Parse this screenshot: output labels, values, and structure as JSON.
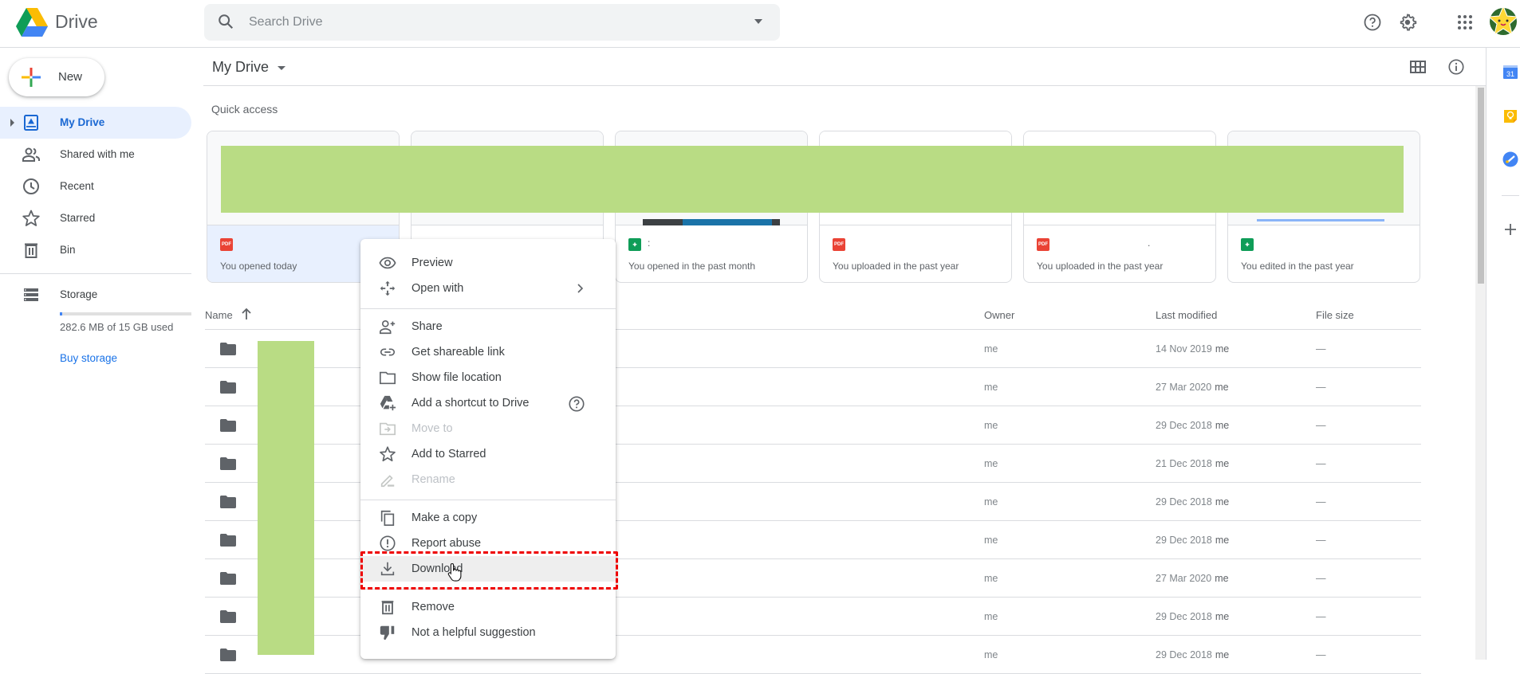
{
  "header": {
    "app_title": "Drive",
    "search_placeholder": "Search Drive",
    "icons": [
      "help-icon",
      "settings-icon",
      "apps-grid-icon",
      "avatar"
    ]
  },
  "sidebar": {
    "new_label": "New",
    "items": [
      {
        "label": "My Drive",
        "icon": "my-drive-icon",
        "active": true
      },
      {
        "label": "Shared with me",
        "icon": "shared-icon"
      },
      {
        "label": "Recent",
        "icon": "clock-icon"
      },
      {
        "label": "Starred",
        "icon": "star-icon"
      },
      {
        "label": "Bin",
        "icon": "trash-icon"
      }
    ],
    "storage": {
      "label": "Storage",
      "used_text": "282.6 MB of 15 GB used",
      "used_fraction": 0.018,
      "buy_label": "Buy storage"
    }
  },
  "toolbar": {
    "breadcrumb": "My Drive",
    "icons": [
      "grid-view-icon",
      "info-icon"
    ]
  },
  "quick_access": {
    "label": "Quick access",
    "cards": [
      {
        "type": "PDF",
        "reason": "You opened today",
        "selected": true
      },
      {
        "type": "",
        "reason": ""
      },
      {
        "type": "sheet",
        "reason": "You opened in the past month",
        "name": ":"
      },
      {
        "type": "PDF",
        "reason": "You uploaded in the past year"
      },
      {
        "type": "PDF",
        "reason": "You uploaded in the past year",
        "name": "."
      },
      {
        "type": "sheet",
        "reason": "You edited in the past year"
      }
    ]
  },
  "file_list": {
    "columns": {
      "name": "Name",
      "owner": "Owner",
      "modified": "Last modified",
      "size": "File size"
    },
    "rows": [
      {
        "owner": "me",
        "modified": "14 Nov 2019",
        "modified_by": "me",
        "size": "—"
      },
      {
        "owner": "me",
        "modified": "27 Mar 2020",
        "modified_by": "me",
        "size": "—"
      },
      {
        "owner": "me",
        "modified": "29 Dec 2018",
        "modified_by": "me",
        "size": "—"
      },
      {
        "owner": "me",
        "modified": "21 Dec 2018",
        "modified_by": "me",
        "size": "—"
      },
      {
        "owner": "me",
        "modified": "29 Dec 2018",
        "modified_by": "me",
        "size": "—"
      },
      {
        "owner": "me",
        "modified": "29 Dec 2018",
        "modified_by": "me",
        "size": "—"
      },
      {
        "owner": "me",
        "modified": "27 Mar 2020",
        "modified_by": "me",
        "size": "—"
      },
      {
        "owner": "me",
        "modified": "29 Dec 2018",
        "modified_by": "me",
        "size": "—"
      },
      {
        "owner": "me",
        "modified": "29 Dec 2018",
        "modified_by": "me",
        "size": "—"
      }
    ]
  },
  "context_menu": {
    "items": [
      {
        "label": "Preview",
        "icon": "eye-icon"
      },
      {
        "label": "Open with",
        "icon": "move-arrows-icon",
        "submenu": true
      },
      {
        "label": "Share",
        "icon": "person-add-icon"
      },
      {
        "label": "Get shareable link",
        "icon": "link-icon"
      },
      {
        "label": "Show file location",
        "icon": "folder-icon"
      },
      {
        "label": "Add a shortcut to Drive",
        "icon": "drive-shortcut-icon",
        "help": true
      },
      {
        "label": "Move to",
        "icon": "move-to-folder-icon",
        "disabled": true
      },
      {
        "label": "Add to Starred",
        "icon": "star-icon"
      },
      {
        "label": "Rename",
        "icon": "pencil-icon",
        "disabled": true
      },
      {
        "label": "Make a copy",
        "icon": "copy-icon"
      },
      {
        "label": "Report abuse",
        "icon": "alert-icon"
      },
      {
        "label": "Download",
        "icon": "download-icon",
        "hover": true,
        "highlighted": true
      },
      {
        "label": "Remove",
        "icon": "trash-icon"
      },
      {
        "label": "Not a helpful suggestion",
        "icon": "thumbs-down-icon"
      }
    ]
  },
  "colors": {
    "accent": "#1a73e8",
    "active_nav_bg": "#e8f0fe",
    "highlight_border": "#ee0000",
    "redaction": "#b9dc84"
  }
}
